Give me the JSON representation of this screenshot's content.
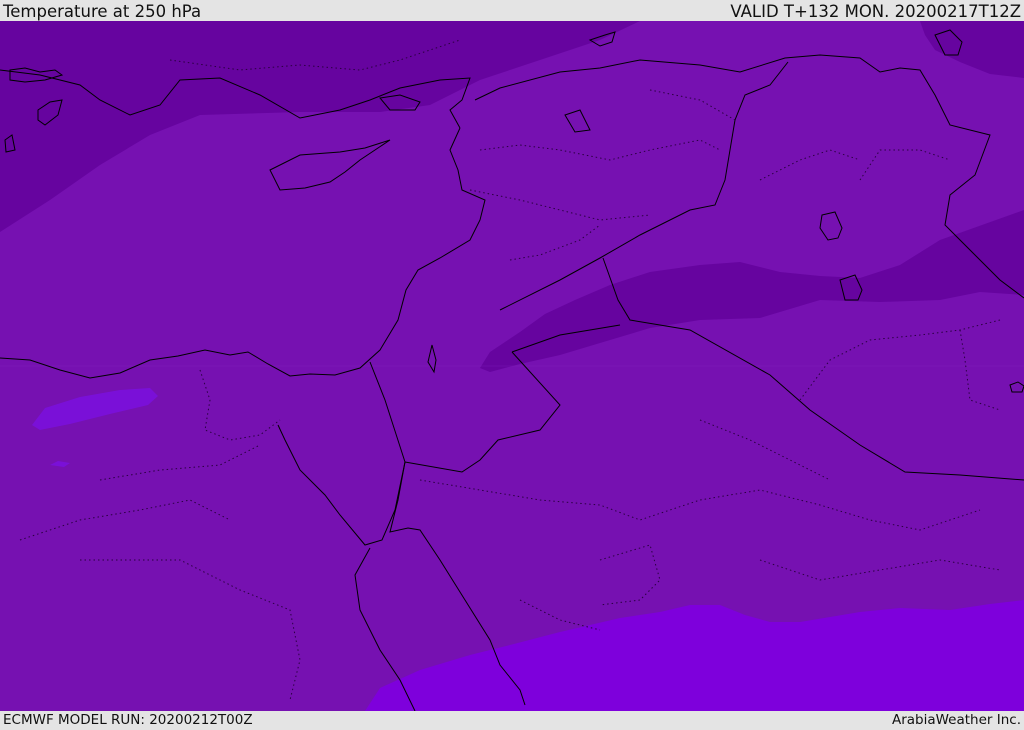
{
  "header": {
    "title": "Temperature at 250 hPa",
    "valid": "VALID T+132 MON. 20200217T12Z"
  },
  "footer": {
    "model_run": "ECMWF MODEL RUN: 20200212T00Z",
    "credit": "ArabiaWeather Inc."
  },
  "map": {
    "field": "temperature-250hPa",
    "colors": {
      "colder_band": "#66049f",
      "base": "#7611b1",
      "warmer_band": "#7e00dc",
      "patch": "#7a10d8",
      "coast": "#000000"
    }
  }
}
